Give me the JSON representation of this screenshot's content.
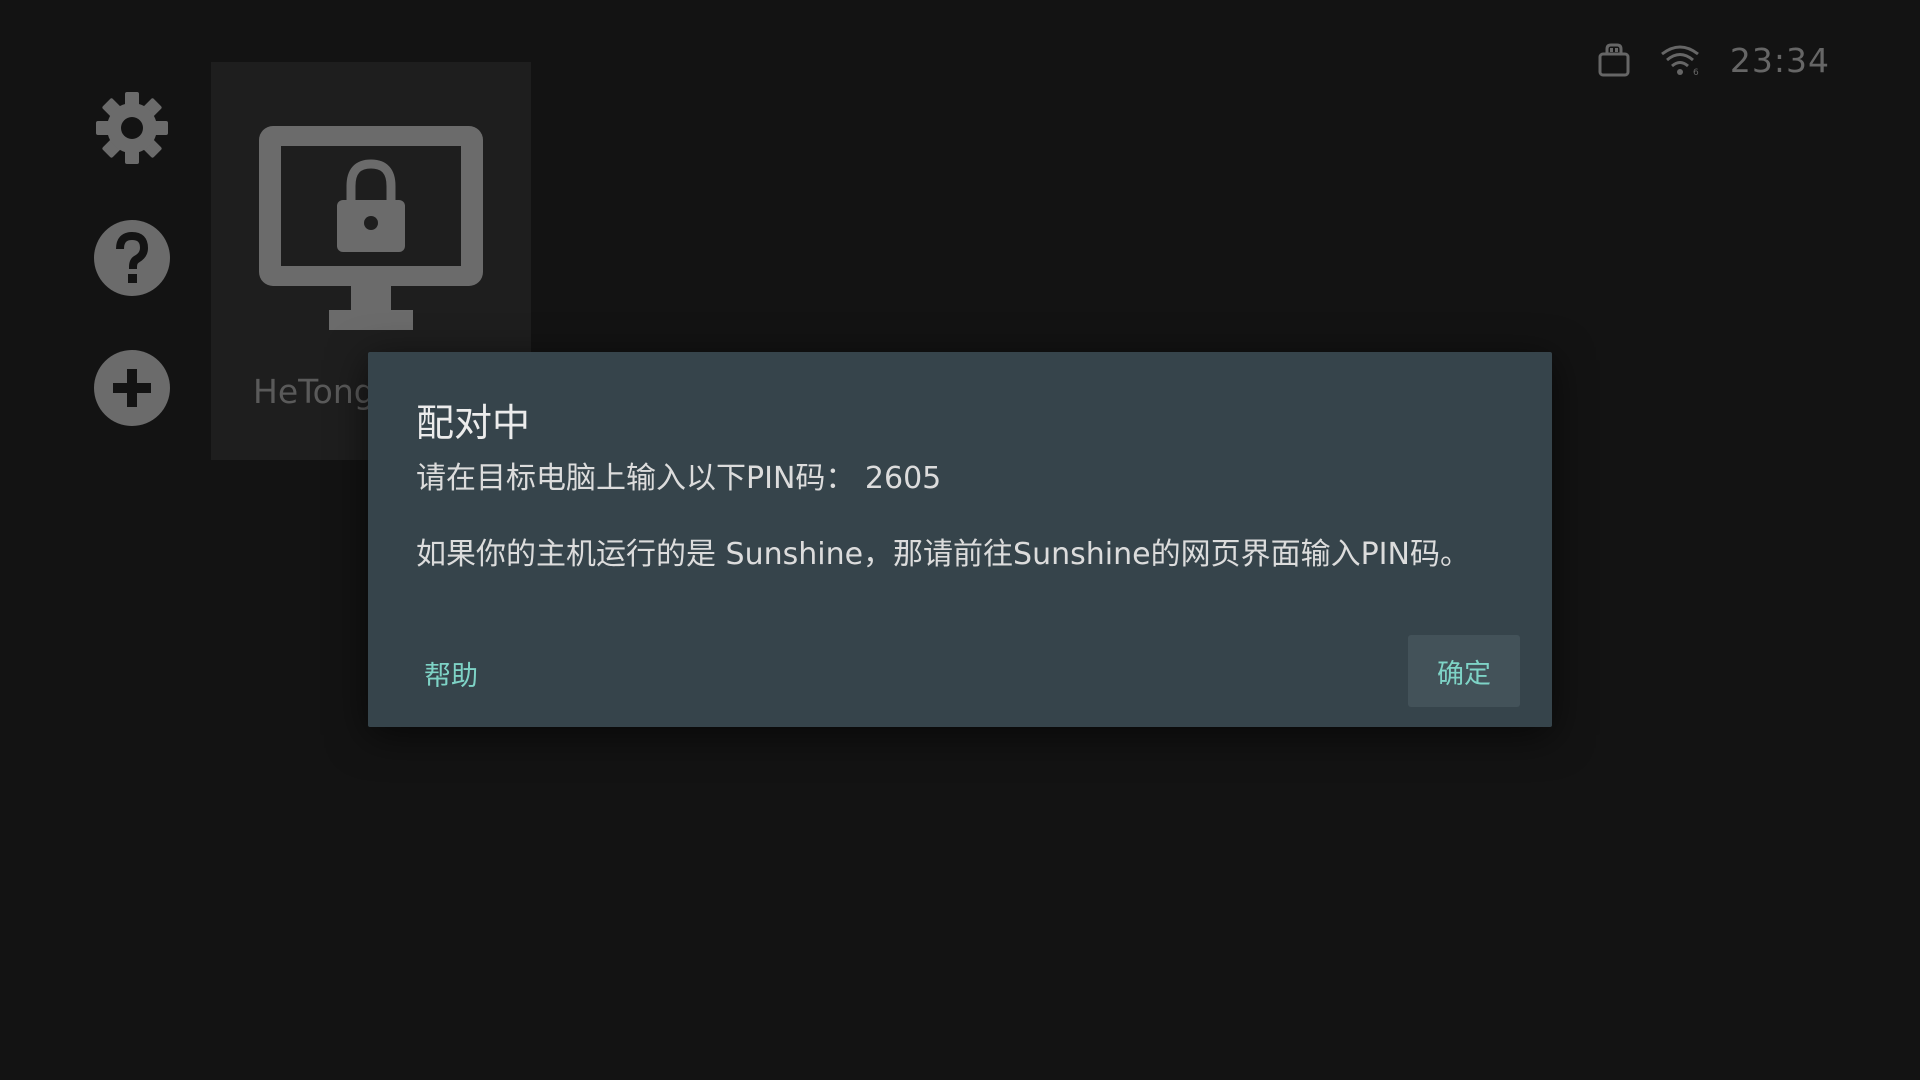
{
  "status_bar": {
    "icons": [
      "lock-icon",
      "wifi-icon"
    ],
    "time": "23:34"
  },
  "sidebar": {
    "items": [
      {
        "icon": "settings-gear-icon"
      },
      {
        "icon": "help-question-icon"
      },
      {
        "icon": "add-plus-icon"
      }
    ]
  },
  "pc_tile": {
    "icon": "locked-monitor-icon",
    "name": "HeTong"
  },
  "dialog": {
    "title": "配对中",
    "message": "请在目标电脑上输入以下PIN码： 2605\n\n如果你的主机运行的是 Sunshine，那请前往Sunshine的网页界面输入PIN码。",
    "help_label": "帮助",
    "ok_label": "确定"
  },
  "colors": {
    "background": "#131313",
    "icon_gray": "#6b6b6b",
    "dialog_bg": "#36444b",
    "accent": "#7ed3c6"
  }
}
